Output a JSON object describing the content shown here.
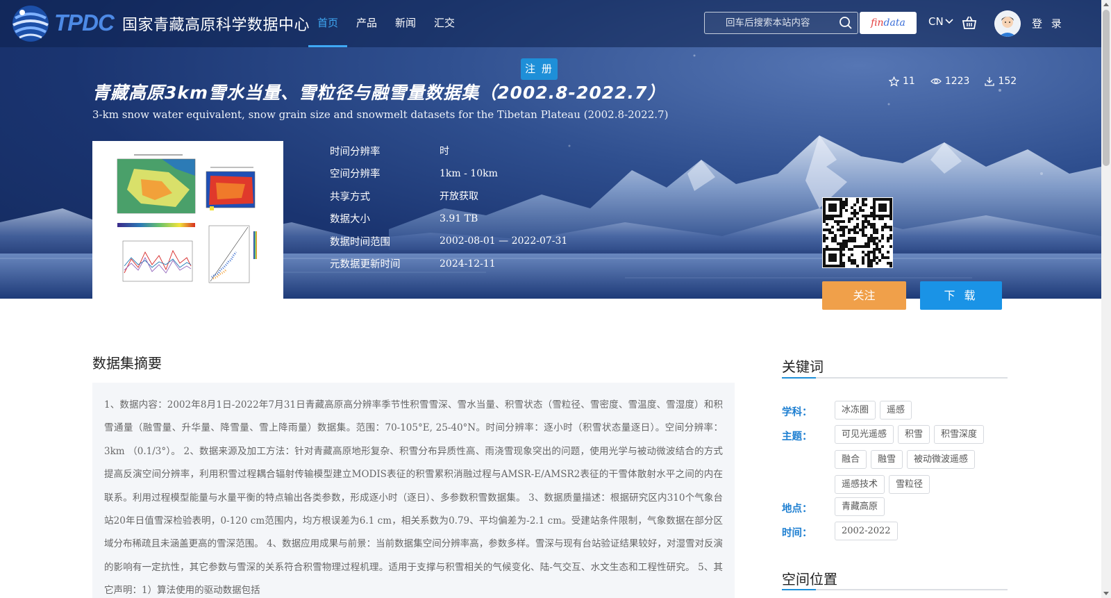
{
  "header": {
    "logo_text": "TPDC",
    "site_name": "国家青藏高原科学数据中心",
    "nav": [
      {
        "label": "首页"
      },
      {
        "label": "产品"
      },
      {
        "label": "新闻"
      },
      {
        "label": "汇交"
      }
    ],
    "search_placeholder": "回车后搜索本站内容",
    "findata_part1": "fin",
    "findata_part2": "data",
    "lang": "CN",
    "login": "登 录",
    "register": "注 册"
  },
  "dataset": {
    "title_cn": "青藏高原3km雪水当量、雪粒径与融雪量数据集（2002.8-2022.7）",
    "title_en": "3-km snow water equivalent, snow grain size and snowmelt datasets for the Tibetan Plateau (2002.8-2022.7)",
    "stars": "11",
    "views": "1223",
    "downloads": "152",
    "info": [
      {
        "label": "时间分辨率",
        "value": "时"
      },
      {
        "label": "空间分辨率",
        "value": "1km - 10km"
      },
      {
        "label": "共享方式",
        "value": "开放获取"
      },
      {
        "label": "数据大小",
        "value": "3.91 TB"
      },
      {
        "label": "数据时间范围",
        "value": "2002-08-01 — 2022-07-31"
      },
      {
        "label": "元数据更新时间",
        "value": "2024-12-11"
      }
    ],
    "follow": "关注",
    "download": "下 载"
  },
  "summary": {
    "title": "数据集摘要",
    "text": "1、数据内容：2002年8月1日-2022年7月31日青藏高原高分辨率季节性积雪雪深、雪水当量、积雪状态（雪粒径、雪密度、雪温度、雪湿度）和积雪通量（融雪量、升华量、降雪量、雪上降雨量）数据集。范围：70-105°E, 25-40°N。时间分辨率：逐小时（积雪状态量逐日）。空间分辨率：3km （0.1/3°）。 2、数据来源及加工方法：针对青藏高原地形复杂、积雪分布异质性高、雨浇雪现象突出的问题，使用光学与被动微波结合的方式提高反演空间分辨率，利用积雪过程耦合辐射传输模型建立MODIS表征的积雪累积消融过程与AMSR-E/AMSR2表征的干雪体散射水平之间的内在联系。利用过程模型能量与水量平衡的特点输出各类参数，形成逐小时（逐日）、多参数积雪数据集。 3、数据质量描述：根据研究区内310个气象台站20年日值雪深检验表明，0-120 cm范围内，均方根误差为6.1 cm，相关系数为0.79、平均偏差为-2.1 cm。受建站条件限制，气象数据在部分区域分布稀疏且未涵盖更高的雪深范围。 4、数据应用成果与前景：当前数据集空间分辨率高，参数多样。雪深与现有台站验证结果较好，对湿雪对反演的影响有一定抗性，其它参数与雪深的关系符合积雪物理过程机理。适用于支撑与积雪相关的气候变化、陆-气交互、水文生态和工程性研究。 5、其它声明：1）算法使用的驱动数据包括"
  },
  "keywords": {
    "title": "关键词",
    "groups": [
      {
        "label": "学科：",
        "tags": [
          "冰冻圈",
          "遥感"
        ]
      },
      {
        "label": "主题：",
        "tags": [
          "可见光遥感",
          "积雪",
          "积雪深度",
          "融合",
          "融雪",
          "被动微波遥感",
          "遥感技术",
          "雪粒径"
        ]
      },
      {
        "label": "地点：",
        "tags": [
          "青藏高原"
        ]
      },
      {
        "label": "时间：",
        "tags": [
          "2002-2022"
        ]
      }
    ]
  },
  "space": {
    "title": "空间位置"
  }
}
